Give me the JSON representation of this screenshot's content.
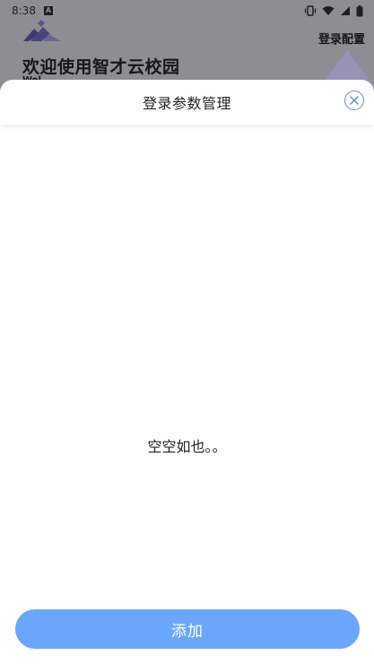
{
  "status_bar": {
    "time": "8:38",
    "notification_icon": "a-icon"
  },
  "background_page": {
    "config_label": "登录配置",
    "welcome_title": "欢迎使用智才云校园",
    "subtitle": "Wel..."
  },
  "sheet": {
    "title": "登录参数管理",
    "empty_text": "空空如也。。",
    "add_label": "添加"
  },
  "colors": {
    "accent": "#5b8ee8",
    "button": "#6aa6fb",
    "dim_overlay": "#8e8d94"
  }
}
